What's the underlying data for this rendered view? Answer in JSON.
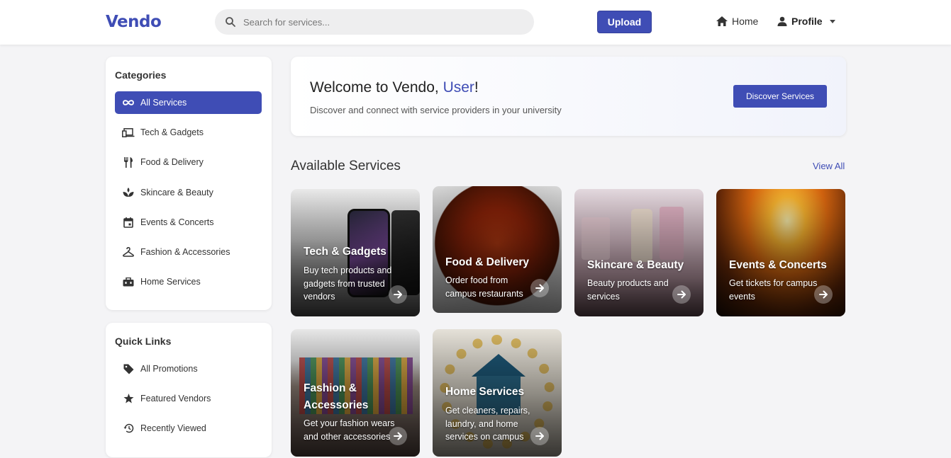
{
  "header": {
    "logo": "Vendo",
    "search_placeholder": "Search for services...",
    "upload_label": "Upload",
    "home_label": "Home",
    "profile_label": "Profile"
  },
  "categories": {
    "title": "Categories",
    "items": [
      {
        "label": "All Services",
        "icon": "infinity-icon",
        "active": true
      },
      {
        "label": "Tech & Gadgets",
        "icon": "devices-icon"
      },
      {
        "label": "Food & Delivery",
        "icon": "utensils-icon"
      },
      {
        "label": "Skincare & Beauty",
        "icon": "spa-icon"
      },
      {
        "label": "Events & Concerts",
        "icon": "calendar-icon"
      },
      {
        "label": "Fashion & Accessories",
        "icon": "hanger-icon"
      },
      {
        "label": "Home Services",
        "icon": "toolbox-icon"
      }
    ]
  },
  "quick_links": {
    "title": "Quick Links",
    "items": [
      {
        "label": "All Promotions",
        "icon": "tag-icon"
      },
      {
        "label": "Featured Vendors",
        "icon": "star-icon"
      },
      {
        "label": "Recently Viewed",
        "icon": "history-icon"
      }
    ]
  },
  "welcome": {
    "title_prefix": "Welcome to Vendo, ",
    "user": "User",
    "title_suffix": "!",
    "subtitle": "Discover and connect with service providers in your university",
    "button": "Discover Services"
  },
  "services": {
    "title": "Available Services",
    "view_all": "View All",
    "tiles": [
      {
        "title": "Tech & Gadgets",
        "desc": "Buy tech products and gadgets from trusted vendors"
      },
      {
        "title": "Food & Delivery",
        "desc": "Order food from campus restaurants"
      },
      {
        "title": "Skincare & Beauty",
        "desc": "Beauty products and services"
      },
      {
        "title": "Events & Concerts",
        "desc": "Get tickets for campus events"
      },
      {
        "title": "Fashion & Accessories",
        "desc": "Get your fashion wears and other accessories"
      },
      {
        "title": "Home Services",
        "desc": "Get cleaners, repairs, laundry, and home services on campus"
      }
    ]
  },
  "colors": {
    "accent": "#3f4db5",
    "background": "#f4f4f6"
  }
}
